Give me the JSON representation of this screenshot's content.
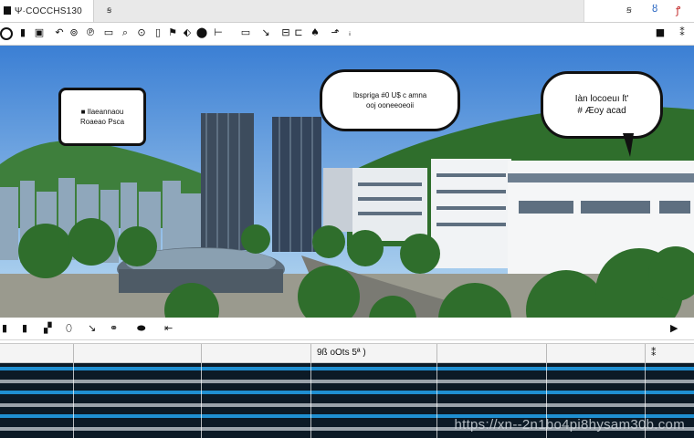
{
  "tab": {
    "title": "Ψ·COCCHS130",
    "close_glyph": "ꞩ"
  },
  "window_controls": {
    "minimize": "ꞩ",
    "info": "ȣ",
    "close": "ꝭ"
  },
  "toolbar": {
    "icons": [
      "power-icon",
      "open-icon",
      "save-icon",
      "undo-icon",
      "redo-icon",
      "print-icon",
      "preview-icon",
      "search-icon",
      "clip-icon",
      "target-icon",
      "flag-icon",
      "export-icon",
      "folder-icon",
      "pen-icon",
      "cut-icon",
      "bookmark-icon",
      "lock-icon",
      "tag-icon"
    ],
    "right_icons": [
      "stop-icon",
      "settings-icon"
    ]
  },
  "scene": {
    "bubble_left": {
      "line1": "■ Ilaeannaou",
      "line2": "Roaeao Psca"
    },
    "bubble_mid": {
      "line1": "Ibspriga #0 U$ c amna",
      "line2": "ooj ooneeoeoii"
    },
    "bubble_right": {
      "line1": "Iàn locoeuı ſt'",
      "line2": "# Æoy acad"
    },
    "colors": {
      "sky_top": "#3b7fd4",
      "sky_bottom": "#bcdcf2",
      "hills": "#3e7f3c",
      "trees": "#2f6e2c"
    }
  },
  "timeline": {
    "tools": [
      "marker-icon",
      "cut-icon",
      "clip-icon",
      "dot-icon",
      "cursor-icon",
      "refresh-icon",
      "zoom-icon",
      "arrow-icon"
    ],
    "header_label": "9ß oOts 5ª )",
    "watermark": "https://xn--2n1bo4pi8hysam30b.com",
    "colors": {
      "track_bg": "#0c1a26",
      "track_blue": "#1f8fd1",
      "track_grey": "#9aa3ab"
    }
  }
}
